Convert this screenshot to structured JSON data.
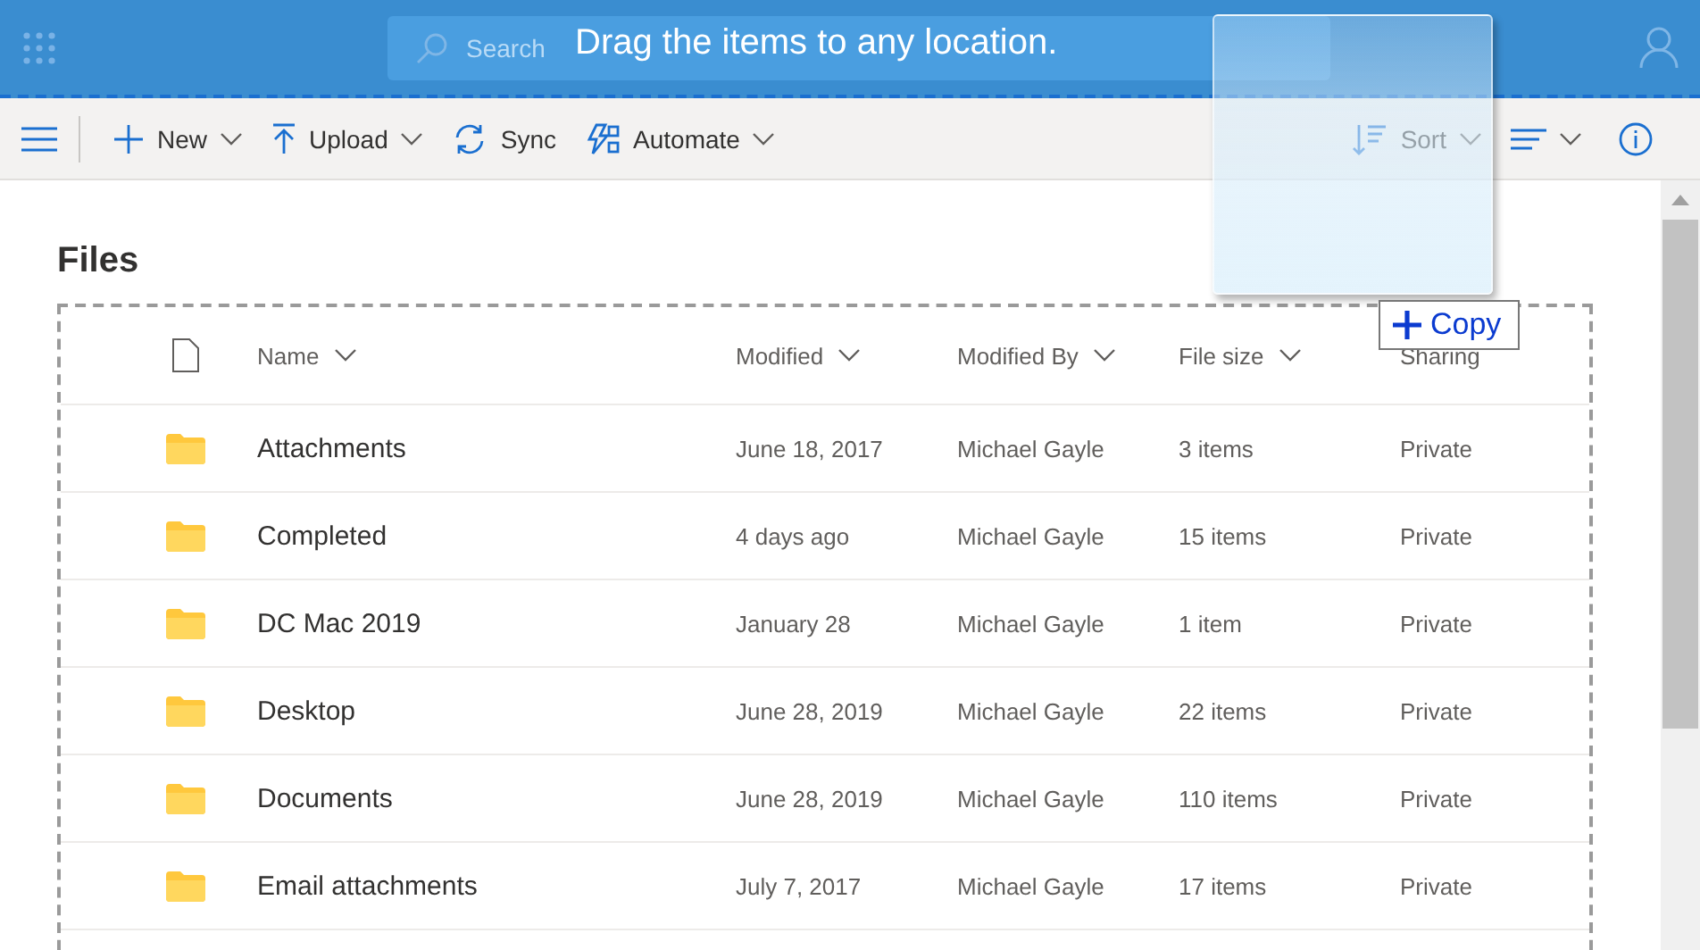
{
  "header": {
    "search": {
      "placeholder": "Search"
    },
    "banner": "Drag the items to any location."
  },
  "toolbar": {
    "left": [
      {
        "kind": "new",
        "label": "New",
        "dropdown": true
      },
      {
        "kind": "upload",
        "label": "Upload",
        "dropdown": true
      },
      {
        "kind": "sync",
        "label": "Sync",
        "dropdown": false
      },
      {
        "kind": "automate",
        "label": "Automate",
        "dropdown": true
      }
    ],
    "sort": {
      "label": "Sort"
    }
  },
  "page": {
    "title": "Files"
  },
  "drag": {
    "badge": "Copy"
  },
  "table": {
    "columns": [
      {
        "label": "Name",
        "sortable": true
      },
      {
        "label": "Modified",
        "sortable": true
      },
      {
        "label": "Modified By",
        "sortable": true
      },
      {
        "label": "File size",
        "sortable": true
      },
      {
        "label": "Sharing",
        "sortable": false
      }
    ],
    "rows": [
      {
        "name": "Attachments",
        "modified": "June 18, 2017",
        "modified_by": "Michael Gayle",
        "size": "3 items",
        "sharing": "Private"
      },
      {
        "name": "Completed",
        "modified": "4 days ago",
        "modified_by": "Michael Gayle",
        "size": "15 items",
        "sharing": "Private"
      },
      {
        "name": "DC Mac 2019",
        "modified": "January 28",
        "modified_by": "Michael Gayle",
        "size": "1 item",
        "sharing": "Private"
      },
      {
        "name": "Desktop",
        "modified": "June 28, 2019",
        "modified_by": "Michael Gayle",
        "size": "22 items",
        "sharing": "Private"
      },
      {
        "name": "Documents",
        "modified": "June 28, 2019",
        "modified_by": "Michael Gayle",
        "size": "110 items",
        "sharing": "Private"
      },
      {
        "name": "Email attachments",
        "modified": "July 7, 2017",
        "modified_by": "Michael Gayle",
        "size": "17 items",
        "sharing": "Private"
      }
    ]
  }
}
